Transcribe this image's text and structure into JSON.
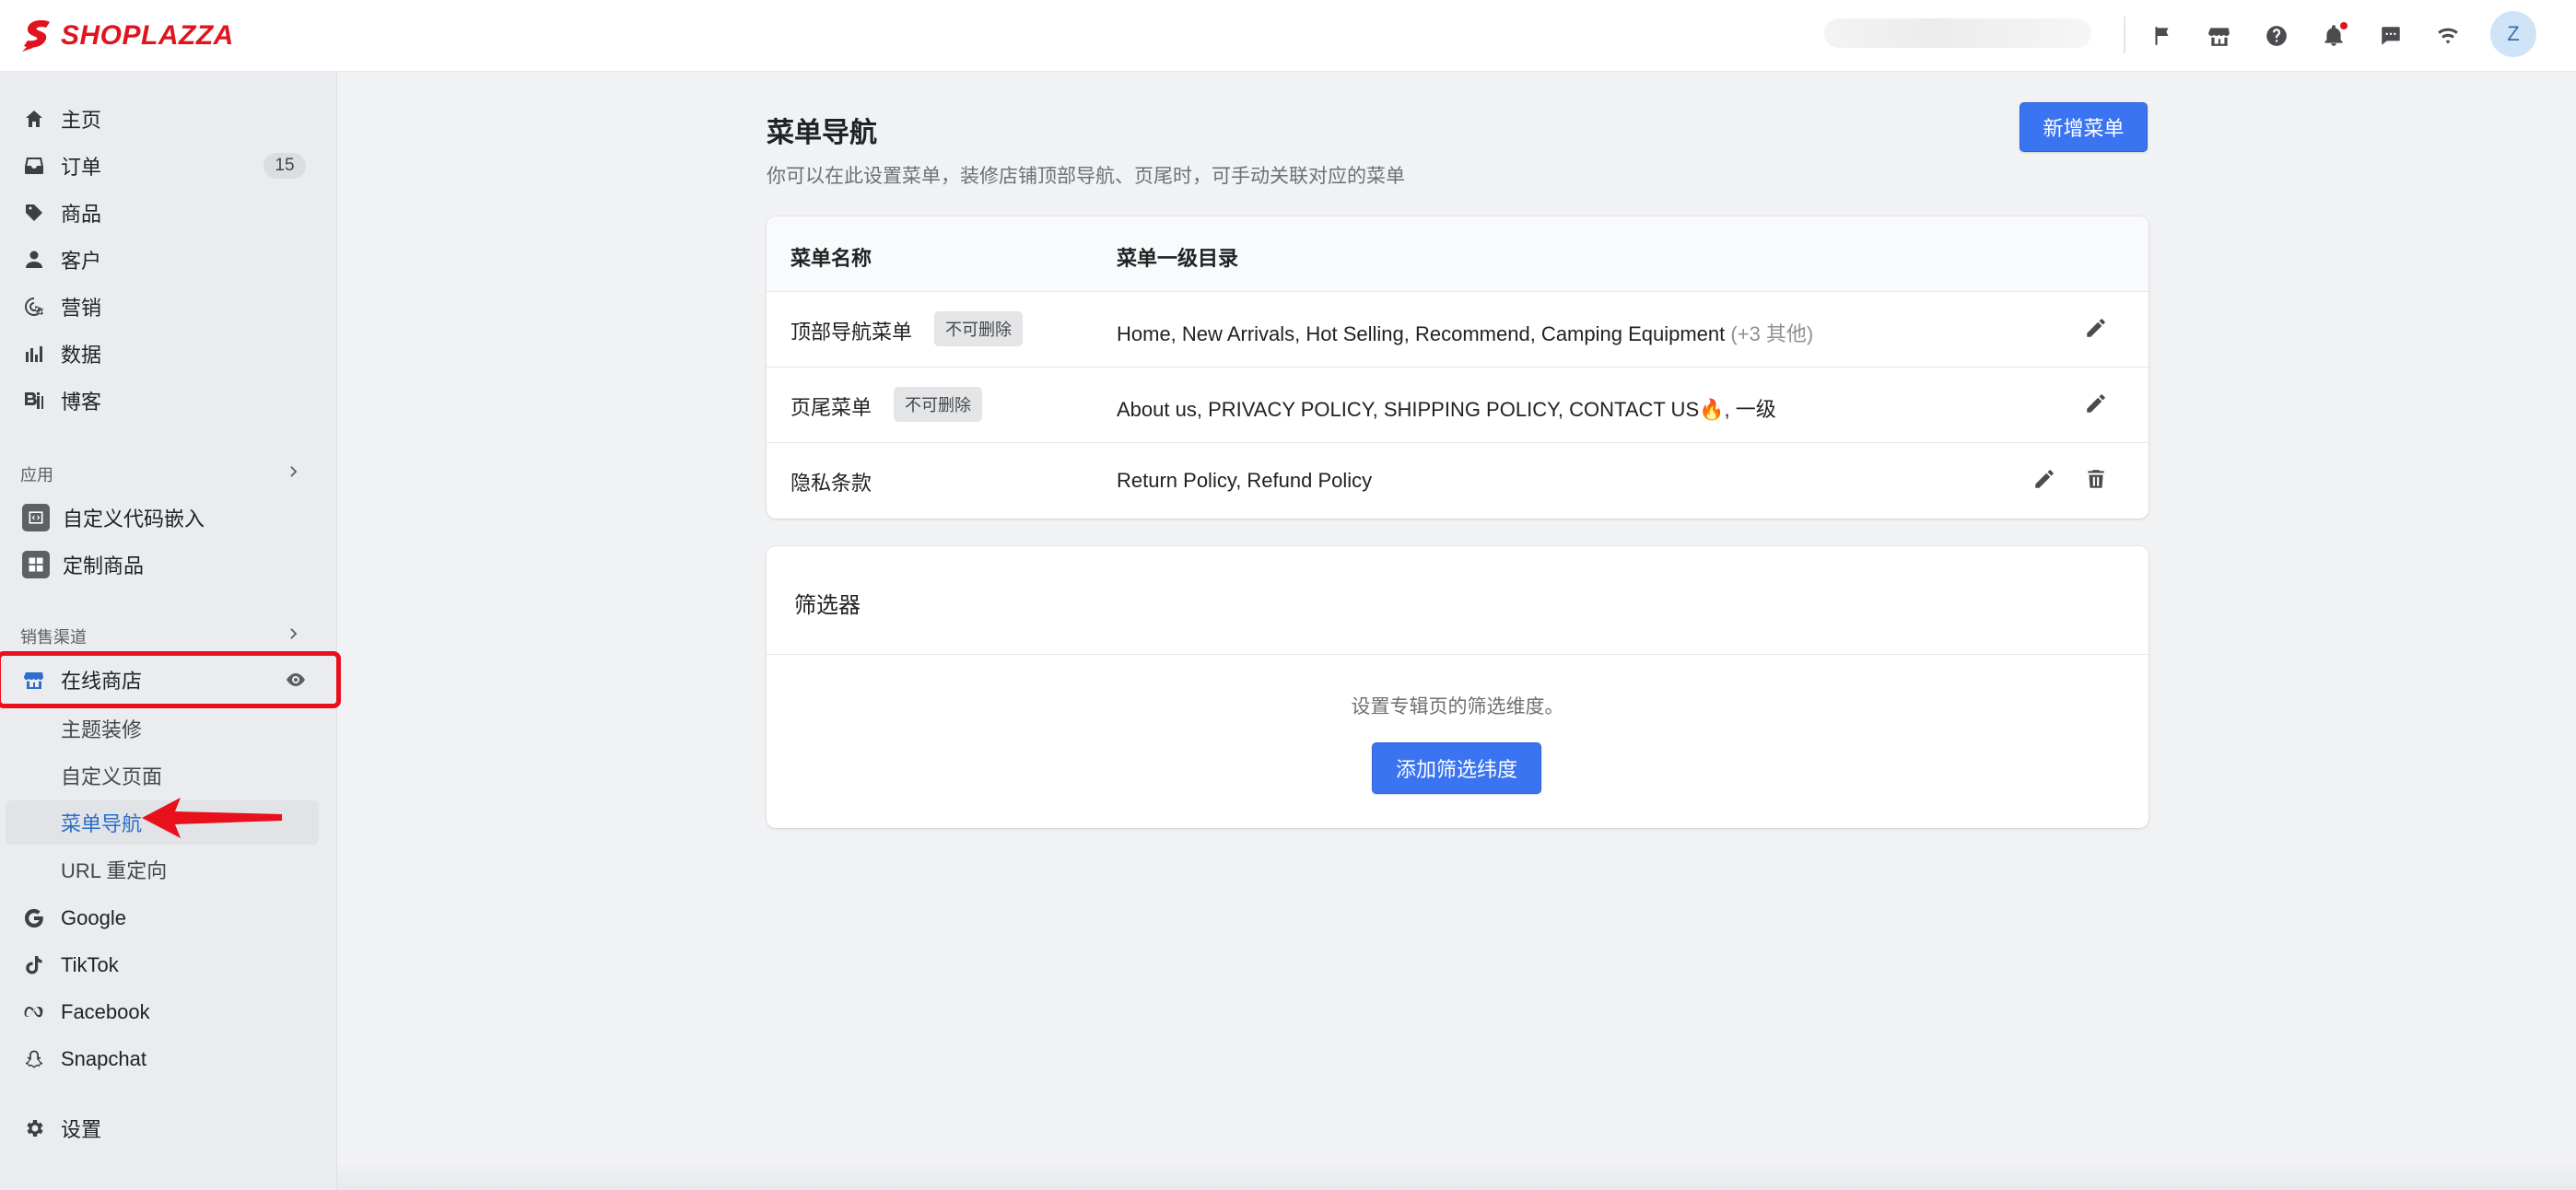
{
  "brand": {
    "name": "SHOPLAZZA",
    "color": "#e0141e"
  },
  "topbar": {
    "icons": [
      "flag-icon",
      "store-icon",
      "help-icon",
      "bell-icon",
      "chat-icon",
      "wifi-icon"
    ],
    "avatar_initial": "Z"
  },
  "sidebar": {
    "main_items": [
      {
        "label": "主页",
        "icon": "home-icon"
      },
      {
        "label": "订单",
        "icon": "inbox-icon",
        "count": "15"
      },
      {
        "label": "商品",
        "icon": "tag-icon"
      },
      {
        "label": "客户",
        "icon": "person-icon"
      },
      {
        "label": "营销",
        "icon": "marketing-icon"
      },
      {
        "label": "数据",
        "icon": "bar-chart-icon"
      },
      {
        "label": "博客",
        "icon": "blog-icon"
      }
    ],
    "apps_section": {
      "label": "应用",
      "items": [
        {
          "label": "自定义代码嵌入",
          "icon": "code-embed-icon"
        },
        {
          "label": "定制商品",
          "icon": "custom-product-icon"
        }
      ]
    },
    "channels_section": {
      "label": "销售渠道",
      "online_store": {
        "label": "在线商店",
        "icon": "storefront-icon"
      },
      "sub_items": [
        {
          "label": "主题装修",
          "active": false
        },
        {
          "label": "自定义页面",
          "active": false
        },
        {
          "label": "菜单导航",
          "active": true
        },
        {
          "label": "URL 重定向",
          "active": false
        }
      ],
      "channels": [
        {
          "label": "Google",
          "icon": "google-icon"
        },
        {
          "label": "TikTok",
          "icon": "tiktok-icon"
        },
        {
          "label": "Facebook",
          "icon": "meta-icon"
        },
        {
          "label": "Snapchat",
          "icon": "snapchat-icon"
        }
      ]
    },
    "settings": {
      "label": "设置",
      "icon": "gear-icon"
    }
  },
  "main": {
    "title": "菜单导航",
    "subtitle": "你可以在此设置菜单，装修店铺顶部导航、页尾时，可手动关联对应的菜单",
    "add_button": "新增菜单",
    "table": {
      "headers": [
        "菜单名称",
        "菜单一级目录"
      ],
      "rows": [
        {
          "name": "顶部导航菜单",
          "tag": "不可删除",
          "items": "Home, New Arrivals, Hot Selling, Recommend, Camping Equipment",
          "more": "(+3 其他)",
          "deletable": false
        },
        {
          "name": "页尾菜单",
          "tag": "不可删除",
          "items": "About us, PRIVACY POLICY, SHIPPING POLICY, CONTACT US🔥, 一级",
          "more": "",
          "deletable": false
        },
        {
          "name": "隐私条款",
          "tag": "",
          "items": "Return Policy, Refund Policy",
          "more": "",
          "deletable": true
        }
      ]
    },
    "filter_card": {
      "title": "筛选器",
      "description": "设置专辑页的筛选维度。",
      "button": "添加筛选纬度"
    }
  },
  "colors": {
    "primary": "#3b74f0",
    "active_text": "#2c6ecb",
    "annotation": "#e8101c"
  }
}
